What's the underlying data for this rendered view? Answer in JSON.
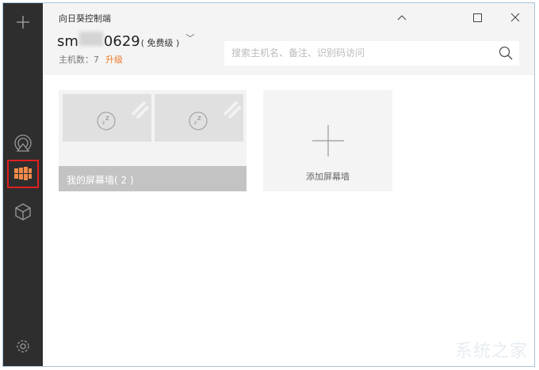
{
  "header": {
    "title": "向日葵控制端",
    "account_prefix": "sm",
    "account_suffix": "0629",
    "tier": "( 免费级 )",
    "host_count": "主机数：7",
    "upgrade": "升级"
  },
  "search": {
    "placeholder": "搜索主机名、备注、识别码访问"
  },
  "cards": [
    {
      "label": "我的屏幕墙( 2 )"
    }
  ],
  "add_card": {
    "label": "添加屏幕墙"
  },
  "watermark": "系统之家",
  "colors": {
    "sidebar": "#2e2e2e",
    "accent": "#f07a2a",
    "highlight": "#e02020"
  }
}
